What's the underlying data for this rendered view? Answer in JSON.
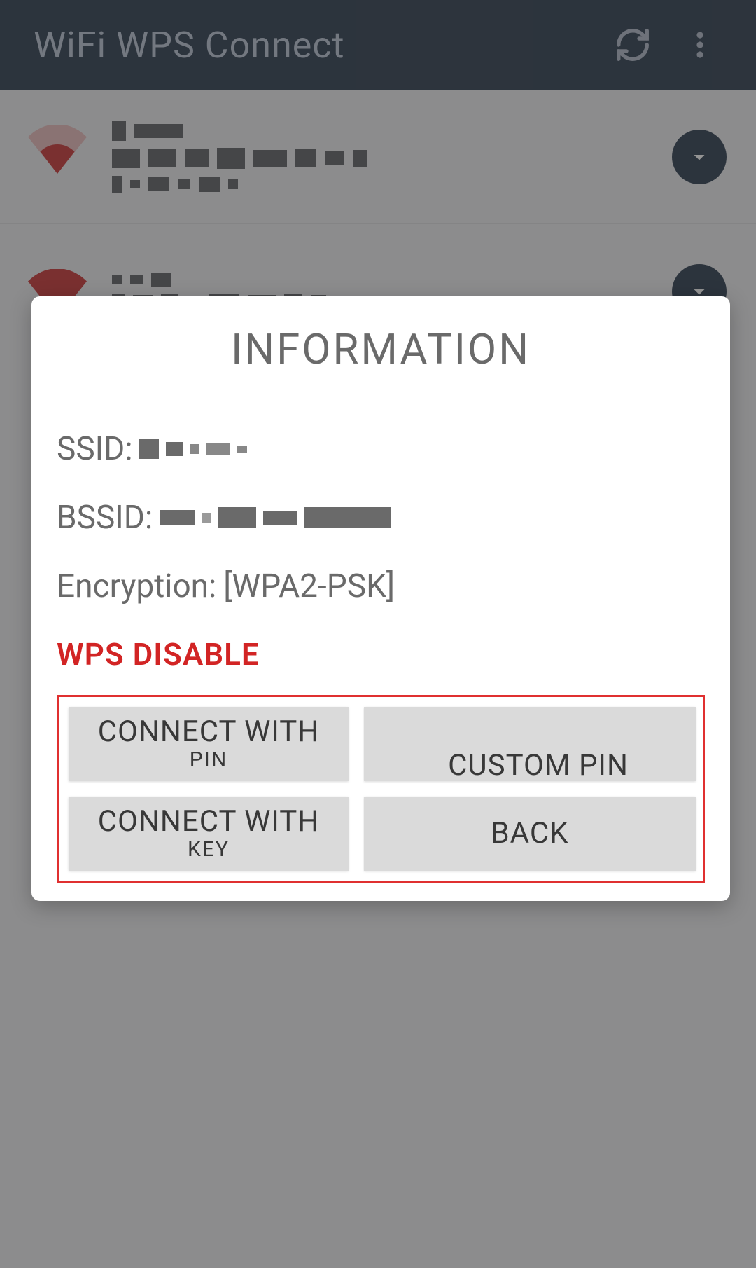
{
  "appbar": {
    "title": "WiFi WPS Connect",
    "refresh_icon": "refresh-icon",
    "more_icon": "more-vert-icon"
  },
  "list": {
    "items": [
      {
        "expand_icon": "chevron-down-icon"
      },
      {
        "expand_icon": "chevron-down-icon"
      }
    ]
  },
  "dialog": {
    "title": "INFORMATION",
    "ssid_label": "SSID:",
    "bssid_label": "BSSID:",
    "encryption_label": "Encryption:",
    "encryption_value": "[WPA2-PSK]",
    "wps_status": "WPS DISABLE",
    "buttons": {
      "connect_pin_l1": "CONNECT WITH",
      "connect_pin_l2": "PIN",
      "custom": "CUSTOM PIN",
      "connect_key_l1": "CONNECT WITH",
      "connect_key_l2": "KEY",
      "back": "BACK"
    }
  }
}
